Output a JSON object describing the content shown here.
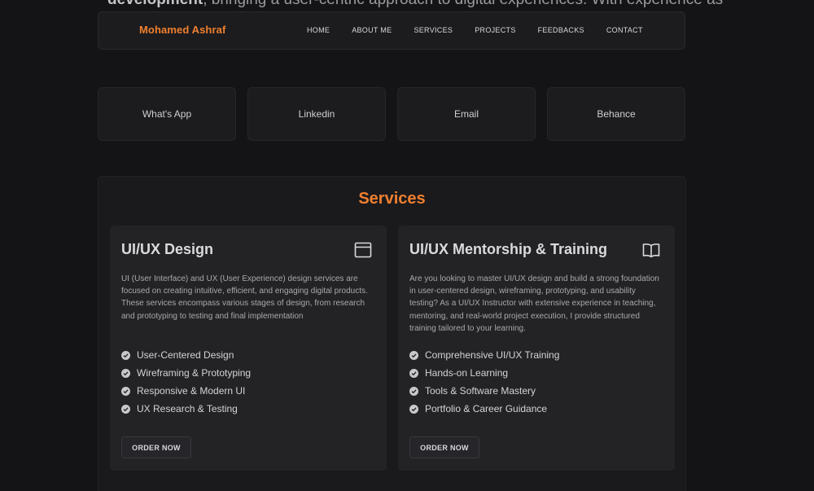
{
  "background_text": {
    "bold": "development",
    "rest": ", bringing a user-centric approach to digital experiences. With experience as"
  },
  "navbar": {
    "brand": "Mohamed Ashraf",
    "links": [
      "HOME",
      "ABOUT ME",
      "SERVICES",
      "PROJECTS",
      "FEEDBACKS",
      "CONTACT"
    ]
  },
  "contacts": [
    "What's App",
    "Linkedin",
    "Email",
    "Behance"
  ],
  "services": {
    "title": "Services",
    "cards": [
      {
        "title": "UI/UX Design",
        "icon": "browser-window-icon",
        "description": "UI (User Interface) and UX (User Experience) design services are focused on creating intuitive, efficient, and engaging digital products. These services encompass various stages of design, from research and prototyping to testing and final implementation",
        "features": [
          "User-Centered Design",
          "Wireframing & Prototyping",
          "Responsive & Modern UI",
          "UX Research & Testing"
        ],
        "button": "ORDER NOW"
      },
      {
        "title": "UI/UX Mentorship & Training",
        "icon": "open-book-icon",
        "description": "Are you looking to master UI/UX design and build a strong foundation in user-centered design, wireframing, prototyping, and usability testing? As a UI/UX Instructor with extensive experience in teaching, mentoring, and real-world project execution, I provide structured training tailored to your learning.",
        "features": [
          "Comprehensive UI/UX Training",
          "Hands-on Learning",
          "Tools & Software Mastery",
          "Portfolio & Career Guidance"
        ],
        "button": "ORDER NOW"
      }
    ]
  },
  "colors": {
    "accent": "#f07f2e",
    "background": "#141416",
    "card": "#232326"
  }
}
